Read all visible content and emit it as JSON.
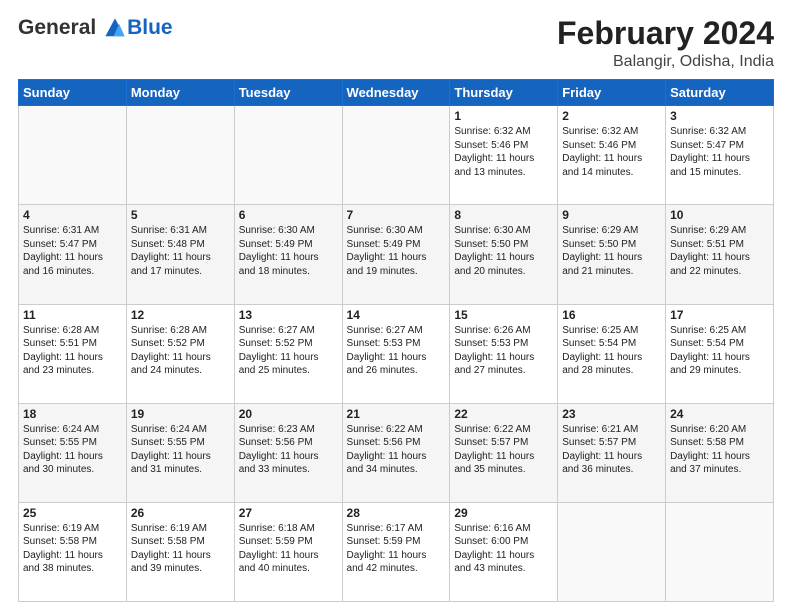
{
  "header": {
    "logo_general": "General",
    "logo_blue": "Blue",
    "cal_title": "February 2024",
    "cal_subtitle": "Balangir, Odisha, India"
  },
  "days_of_week": [
    "Sunday",
    "Monday",
    "Tuesday",
    "Wednesday",
    "Thursday",
    "Friday",
    "Saturday"
  ],
  "weeks": [
    [
      {
        "day": "",
        "info": ""
      },
      {
        "day": "",
        "info": ""
      },
      {
        "day": "",
        "info": ""
      },
      {
        "day": "",
        "info": ""
      },
      {
        "day": "1",
        "info": "Sunrise: 6:32 AM\nSunset: 5:46 PM\nDaylight: 11 hours and 13 minutes."
      },
      {
        "day": "2",
        "info": "Sunrise: 6:32 AM\nSunset: 5:46 PM\nDaylight: 11 hours and 14 minutes."
      },
      {
        "day": "3",
        "info": "Sunrise: 6:32 AM\nSunset: 5:47 PM\nDaylight: 11 hours and 15 minutes."
      }
    ],
    [
      {
        "day": "4",
        "info": "Sunrise: 6:31 AM\nSunset: 5:47 PM\nDaylight: 11 hours and 16 minutes."
      },
      {
        "day": "5",
        "info": "Sunrise: 6:31 AM\nSunset: 5:48 PM\nDaylight: 11 hours and 17 minutes."
      },
      {
        "day": "6",
        "info": "Sunrise: 6:30 AM\nSunset: 5:49 PM\nDaylight: 11 hours and 18 minutes."
      },
      {
        "day": "7",
        "info": "Sunrise: 6:30 AM\nSunset: 5:49 PM\nDaylight: 11 hours and 19 minutes."
      },
      {
        "day": "8",
        "info": "Sunrise: 6:30 AM\nSunset: 5:50 PM\nDaylight: 11 hours and 20 minutes."
      },
      {
        "day": "9",
        "info": "Sunrise: 6:29 AM\nSunset: 5:50 PM\nDaylight: 11 hours and 21 minutes."
      },
      {
        "day": "10",
        "info": "Sunrise: 6:29 AM\nSunset: 5:51 PM\nDaylight: 11 hours and 22 minutes."
      }
    ],
    [
      {
        "day": "11",
        "info": "Sunrise: 6:28 AM\nSunset: 5:51 PM\nDaylight: 11 hours and 23 minutes."
      },
      {
        "day": "12",
        "info": "Sunrise: 6:28 AM\nSunset: 5:52 PM\nDaylight: 11 hours and 24 minutes."
      },
      {
        "day": "13",
        "info": "Sunrise: 6:27 AM\nSunset: 5:52 PM\nDaylight: 11 hours and 25 minutes."
      },
      {
        "day": "14",
        "info": "Sunrise: 6:27 AM\nSunset: 5:53 PM\nDaylight: 11 hours and 26 minutes."
      },
      {
        "day": "15",
        "info": "Sunrise: 6:26 AM\nSunset: 5:53 PM\nDaylight: 11 hours and 27 minutes."
      },
      {
        "day": "16",
        "info": "Sunrise: 6:25 AM\nSunset: 5:54 PM\nDaylight: 11 hours and 28 minutes."
      },
      {
        "day": "17",
        "info": "Sunrise: 6:25 AM\nSunset: 5:54 PM\nDaylight: 11 hours and 29 minutes."
      }
    ],
    [
      {
        "day": "18",
        "info": "Sunrise: 6:24 AM\nSunset: 5:55 PM\nDaylight: 11 hours and 30 minutes."
      },
      {
        "day": "19",
        "info": "Sunrise: 6:24 AM\nSunset: 5:55 PM\nDaylight: 11 hours and 31 minutes."
      },
      {
        "day": "20",
        "info": "Sunrise: 6:23 AM\nSunset: 5:56 PM\nDaylight: 11 hours and 33 minutes."
      },
      {
        "day": "21",
        "info": "Sunrise: 6:22 AM\nSunset: 5:56 PM\nDaylight: 11 hours and 34 minutes."
      },
      {
        "day": "22",
        "info": "Sunrise: 6:22 AM\nSunset: 5:57 PM\nDaylight: 11 hours and 35 minutes."
      },
      {
        "day": "23",
        "info": "Sunrise: 6:21 AM\nSunset: 5:57 PM\nDaylight: 11 hours and 36 minutes."
      },
      {
        "day": "24",
        "info": "Sunrise: 6:20 AM\nSunset: 5:58 PM\nDaylight: 11 hours and 37 minutes."
      }
    ],
    [
      {
        "day": "25",
        "info": "Sunrise: 6:19 AM\nSunset: 5:58 PM\nDaylight: 11 hours and 38 minutes."
      },
      {
        "day": "26",
        "info": "Sunrise: 6:19 AM\nSunset: 5:58 PM\nDaylight: 11 hours and 39 minutes."
      },
      {
        "day": "27",
        "info": "Sunrise: 6:18 AM\nSunset: 5:59 PM\nDaylight: 11 hours and 40 minutes."
      },
      {
        "day": "28",
        "info": "Sunrise: 6:17 AM\nSunset: 5:59 PM\nDaylight: 11 hours and 42 minutes."
      },
      {
        "day": "29",
        "info": "Sunrise: 6:16 AM\nSunset: 6:00 PM\nDaylight: 11 hours and 43 minutes."
      },
      {
        "day": "",
        "info": ""
      },
      {
        "day": "",
        "info": ""
      }
    ]
  ]
}
